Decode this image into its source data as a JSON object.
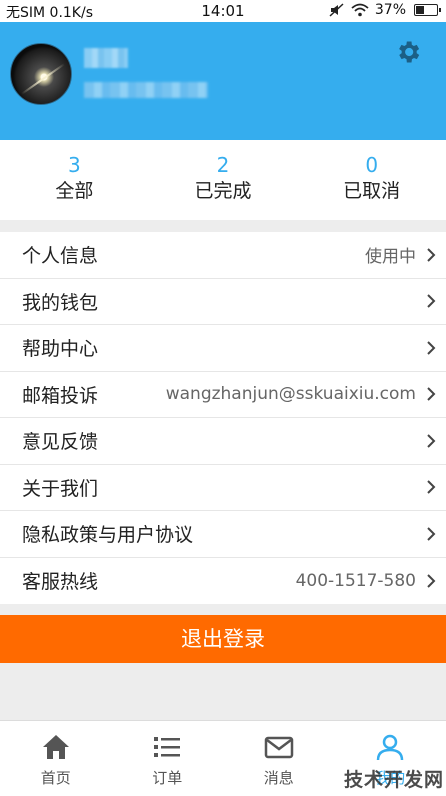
{
  "status_bar": {
    "carrier": "无SIM 0.1K/s",
    "time": "14:01",
    "battery": "37%",
    "battery_level": 0.37
  },
  "profile": {
    "avatar": "avatar",
    "settings_icon": "gear-icon"
  },
  "stats": [
    {
      "count": "3",
      "label": "全部"
    },
    {
      "count": "2",
      "label": "已完成"
    },
    {
      "count": "0",
      "label": "已取消"
    }
  ],
  "menu": [
    {
      "label": "个人信息",
      "value": "使用中"
    },
    {
      "label": "我的钱包",
      "value": ""
    },
    {
      "label": "帮助中心",
      "value": ""
    },
    {
      "label": "邮箱投诉",
      "value": "wangzhanjun@sskuaixiu.com"
    },
    {
      "label": "意见反馈",
      "value": ""
    },
    {
      "label": "关于我们",
      "value": ""
    },
    {
      "label": "隐私政策与用户协议",
      "value": ""
    },
    {
      "label": "客服热线",
      "value": "400-1517-580"
    }
  ],
  "logout_label": "退出登录",
  "tabs": [
    {
      "label": "首页",
      "icon": "home-icon"
    },
    {
      "label": "订单",
      "icon": "list-icon"
    },
    {
      "label": "消息",
      "icon": "mail-icon"
    },
    {
      "label": "我的",
      "icon": "user-icon"
    }
  ],
  "watermark": "技术开发网",
  "colors": {
    "header": "#35adee",
    "accent": "#35adee",
    "logout": "#ff6a00"
  }
}
